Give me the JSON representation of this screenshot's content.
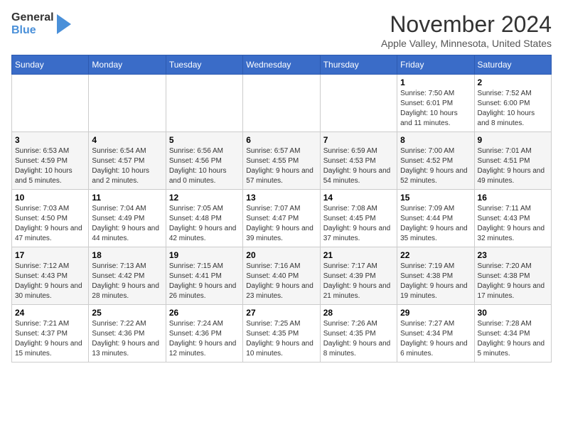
{
  "header": {
    "logo_line1": "General",
    "logo_line2": "Blue",
    "month": "November 2024",
    "location": "Apple Valley, Minnesota, United States"
  },
  "weekdays": [
    "Sunday",
    "Monday",
    "Tuesday",
    "Wednesday",
    "Thursday",
    "Friday",
    "Saturday"
  ],
  "weeks": [
    [
      {
        "day": "",
        "info": ""
      },
      {
        "day": "",
        "info": ""
      },
      {
        "day": "",
        "info": ""
      },
      {
        "day": "",
        "info": ""
      },
      {
        "day": "",
        "info": ""
      },
      {
        "day": "1",
        "info": "Sunrise: 7:50 AM\nSunset: 6:01 PM\nDaylight: 10 hours and 11 minutes."
      },
      {
        "day": "2",
        "info": "Sunrise: 7:52 AM\nSunset: 6:00 PM\nDaylight: 10 hours and 8 minutes."
      }
    ],
    [
      {
        "day": "3",
        "info": "Sunrise: 6:53 AM\nSunset: 4:59 PM\nDaylight: 10 hours and 5 minutes."
      },
      {
        "day": "4",
        "info": "Sunrise: 6:54 AM\nSunset: 4:57 PM\nDaylight: 10 hours and 2 minutes."
      },
      {
        "day": "5",
        "info": "Sunrise: 6:56 AM\nSunset: 4:56 PM\nDaylight: 10 hours and 0 minutes."
      },
      {
        "day": "6",
        "info": "Sunrise: 6:57 AM\nSunset: 4:55 PM\nDaylight: 9 hours and 57 minutes."
      },
      {
        "day": "7",
        "info": "Sunrise: 6:59 AM\nSunset: 4:53 PM\nDaylight: 9 hours and 54 minutes."
      },
      {
        "day": "8",
        "info": "Sunrise: 7:00 AM\nSunset: 4:52 PM\nDaylight: 9 hours and 52 minutes."
      },
      {
        "day": "9",
        "info": "Sunrise: 7:01 AM\nSunset: 4:51 PM\nDaylight: 9 hours and 49 minutes."
      }
    ],
    [
      {
        "day": "10",
        "info": "Sunrise: 7:03 AM\nSunset: 4:50 PM\nDaylight: 9 hours and 47 minutes."
      },
      {
        "day": "11",
        "info": "Sunrise: 7:04 AM\nSunset: 4:49 PM\nDaylight: 9 hours and 44 minutes."
      },
      {
        "day": "12",
        "info": "Sunrise: 7:05 AM\nSunset: 4:48 PM\nDaylight: 9 hours and 42 minutes."
      },
      {
        "day": "13",
        "info": "Sunrise: 7:07 AM\nSunset: 4:47 PM\nDaylight: 9 hours and 39 minutes."
      },
      {
        "day": "14",
        "info": "Sunrise: 7:08 AM\nSunset: 4:45 PM\nDaylight: 9 hours and 37 minutes."
      },
      {
        "day": "15",
        "info": "Sunrise: 7:09 AM\nSunset: 4:44 PM\nDaylight: 9 hours and 35 minutes."
      },
      {
        "day": "16",
        "info": "Sunrise: 7:11 AM\nSunset: 4:43 PM\nDaylight: 9 hours and 32 minutes."
      }
    ],
    [
      {
        "day": "17",
        "info": "Sunrise: 7:12 AM\nSunset: 4:43 PM\nDaylight: 9 hours and 30 minutes."
      },
      {
        "day": "18",
        "info": "Sunrise: 7:13 AM\nSunset: 4:42 PM\nDaylight: 9 hours and 28 minutes."
      },
      {
        "day": "19",
        "info": "Sunrise: 7:15 AM\nSunset: 4:41 PM\nDaylight: 9 hours and 26 minutes."
      },
      {
        "day": "20",
        "info": "Sunrise: 7:16 AM\nSunset: 4:40 PM\nDaylight: 9 hours and 23 minutes."
      },
      {
        "day": "21",
        "info": "Sunrise: 7:17 AM\nSunset: 4:39 PM\nDaylight: 9 hours and 21 minutes."
      },
      {
        "day": "22",
        "info": "Sunrise: 7:19 AM\nSunset: 4:38 PM\nDaylight: 9 hours and 19 minutes."
      },
      {
        "day": "23",
        "info": "Sunrise: 7:20 AM\nSunset: 4:38 PM\nDaylight: 9 hours and 17 minutes."
      }
    ],
    [
      {
        "day": "24",
        "info": "Sunrise: 7:21 AM\nSunset: 4:37 PM\nDaylight: 9 hours and 15 minutes."
      },
      {
        "day": "25",
        "info": "Sunrise: 7:22 AM\nSunset: 4:36 PM\nDaylight: 9 hours and 13 minutes."
      },
      {
        "day": "26",
        "info": "Sunrise: 7:24 AM\nSunset: 4:36 PM\nDaylight: 9 hours and 12 minutes."
      },
      {
        "day": "27",
        "info": "Sunrise: 7:25 AM\nSunset: 4:35 PM\nDaylight: 9 hours and 10 minutes."
      },
      {
        "day": "28",
        "info": "Sunrise: 7:26 AM\nSunset: 4:35 PM\nDaylight: 9 hours and 8 minutes."
      },
      {
        "day": "29",
        "info": "Sunrise: 7:27 AM\nSunset: 4:34 PM\nDaylight: 9 hours and 6 minutes."
      },
      {
        "day": "30",
        "info": "Sunrise: 7:28 AM\nSunset: 4:34 PM\nDaylight: 9 hours and 5 minutes."
      }
    ]
  ]
}
